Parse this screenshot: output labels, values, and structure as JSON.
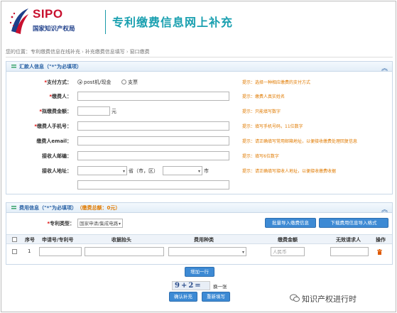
{
  "header": {
    "logo_text": "SIPO",
    "logo_subtitle": "国家知识产权局",
    "site_title": "专利缴费信息网上补充"
  },
  "breadcrumb": {
    "prefix": "您的位置：",
    "items": [
      "专利缴费信息在线补充",
      "补充缴费信息填写",
      "窗口缴费"
    ]
  },
  "payer_panel": {
    "title": "汇款人信息（\"*\"为必填项）",
    "payment_method": {
      "label": "支付方式：",
      "options": [
        "post机/现金",
        "支票"
      ],
      "selected": "post机/现金",
      "hint": "提示：选择一种相应缴费的支付方式"
    },
    "payer_name": {
      "label": "缴费人：",
      "value": "",
      "hint": "提示：缴费人真实姓名"
    },
    "amount": {
      "label": "拟缴费金额：",
      "value": "",
      "unit": "元",
      "hint": "提示：只能填写数字"
    },
    "phone": {
      "label": "缴费人手机号：",
      "value": "",
      "hint": "提示：填写手机号码，11位数字"
    },
    "email": {
      "label": "缴费人email：",
      "value": "",
      "hint": "提示：请正确填写常用邮箱地址，以便接收缴费处理回复信息"
    },
    "postcode": {
      "label": "接收人邮编：",
      "value": "",
      "hint": "提示：填写6位数字"
    },
    "address": {
      "label": "接收人地址：",
      "province_value": "",
      "province_suffix": "省（市，区）",
      "city_value": "",
      "city_suffix": "市",
      "detail_value": "",
      "hint": "提示：请正确填写接收人地址，以便接收缴费收据"
    }
  },
  "fee_panel": {
    "title": "费用信息（\"*\"为必填项）",
    "total": "（缴费总额：0元）",
    "patent_type": {
      "label": "专利类型：",
      "value": "国家申请/集成电路"
    },
    "buttons": {
      "batch_import": "批量导入缴费信息",
      "download_template": "下载费用信息导入格式"
    },
    "columns": [
      "序号",
      "申请号/专利号",
      "收据抬头",
      "费用种类",
      "缴费金额",
      "无效请求人",
      "操作"
    ],
    "rows": [
      {
        "index": "1",
        "app_no": "",
        "receipt_title": "",
        "fee_type": "",
        "amount_placeholder": "人民币",
        "invalid_requester": ""
      }
    ],
    "add_row": "增加一行",
    "captcha_text": "9+2=",
    "captcha_refresh": "换一张",
    "confirm": "确认补充",
    "reset": "重新填写"
  },
  "watermark": "知识产权进行时"
}
